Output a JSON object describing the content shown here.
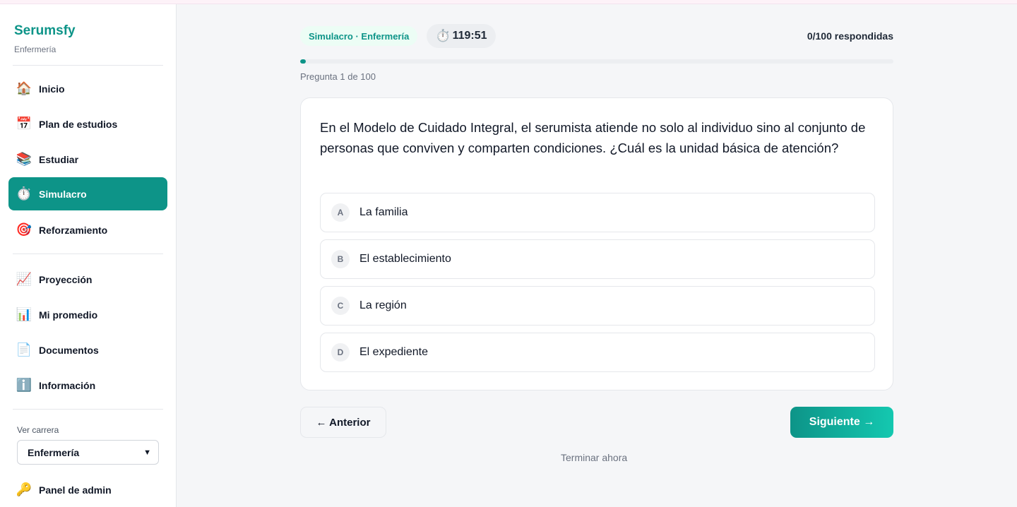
{
  "sidebar": {
    "brand": "Serumsfy",
    "subtitle": "Enfermería",
    "items": [
      {
        "label": "Inicio",
        "icon": "house-icon",
        "glyph": "🏠",
        "active": false
      },
      {
        "label": "Plan de estudios",
        "icon": "calendar-icon",
        "glyph": "📅",
        "active": false
      },
      {
        "label": "Estudiar",
        "icon": "books-icon",
        "glyph": "📚",
        "active": false
      },
      {
        "label": "Simulacro",
        "icon": "stopwatch-icon",
        "glyph": "⏱️",
        "active": true
      },
      {
        "label": "Reforzamiento",
        "icon": "target-icon",
        "glyph": "🎯",
        "active": false
      },
      {
        "label": "Proyección",
        "icon": "chart-increasing-icon",
        "glyph": "📈",
        "active": false
      },
      {
        "label": "Mi promedio",
        "icon": "bar-chart-icon",
        "glyph": "📊",
        "active": false
      },
      {
        "label": "Documentos",
        "icon": "document-icon",
        "glyph": "📄",
        "active": false
      },
      {
        "label": "Información",
        "icon": "info-icon",
        "glyph": "ℹ️",
        "active": false
      }
    ],
    "career_label": "Ver carrera",
    "career_selected": "Enfermería",
    "admin": {
      "label": "Panel de admin",
      "icon": "key-icon",
      "glyph": "🔑"
    }
  },
  "header": {
    "mode_pill": "Simulacro · Enfermería",
    "timer_icon": "stopwatch-icon",
    "timer_glyph": "⏱️",
    "timer": "119:51",
    "answered": "0/100 respondidas",
    "progress": 0.01,
    "question_counter": "Pregunta 1 de 100"
  },
  "question": {
    "text": "En el Modelo de Cuidado Integral, el serumista atiende no solo al individuo sino al conjunto de personas que conviven y comparten condiciones. ¿Cuál es la unidad básica de atención?",
    "options": [
      {
        "letter": "A",
        "text": "La familia"
      },
      {
        "letter": "B",
        "text": "El establecimiento"
      },
      {
        "letter": "C",
        "text": "La región"
      },
      {
        "letter": "D",
        "text": "El expediente"
      }
    ]
  },
  "nav": {
    "prev": "← Anterior",
    "next": "Siguiente →",
    "finish": "Terminar ahora"
  },
  "colors": {
    "accent": "#0d9488",
    "accent_light": "#14c8b0",
    "background": "#f5f6f8"
  }
}
